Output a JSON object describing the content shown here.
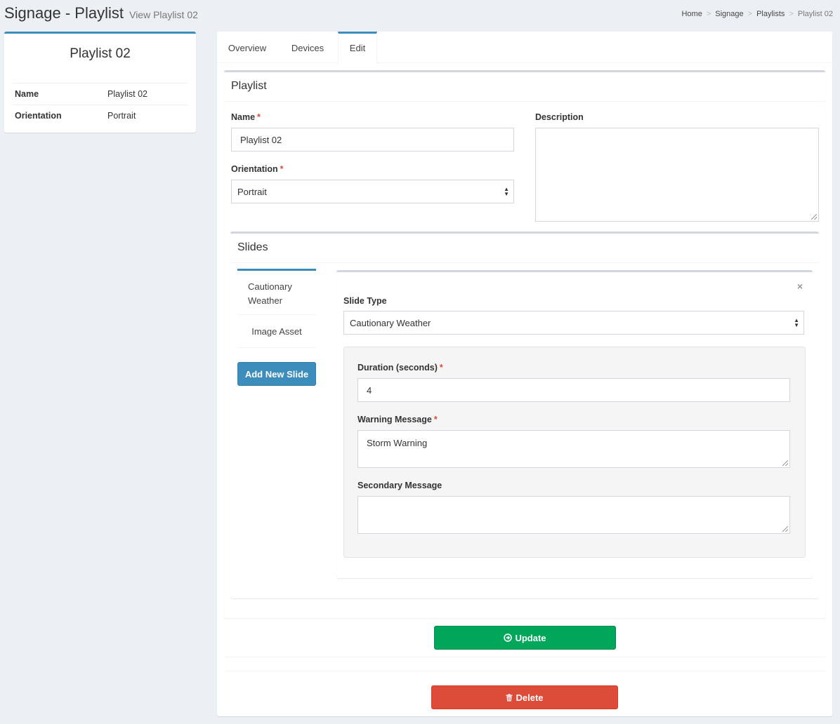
{
  "header": {
    "title": "Signage - Playlist",
    "subtitle": "View Playlist 02",
    "breadcrumb": [
      "Home",
      "Signage",
      "Playlists",
      "Playlist 02"
    ]
  },
  "profile": {
    "name": "Playlist 02",
    "rows": [
      {
        "key": "Name",
        "value": "Playlist 02"
      },
      {
        "key": "Orientation",
        "value": "Portrait"
      }
    ]
  },
  "tabs": [
    "Overview",
    "Devices",
    "Edit"
  ],
  "active_tab": "Edit",
  "playlist_form": {
    "title": "Playlist",
    "name_label": "Name",
    "name_value": "Playlist 02",
    "orientation_label": "Orientation",
    "orientation_value": "Portrait",
    "description_label": "Description",
    "description_value": "",
    "required_mark": "*"
  },
  "slides": {
    "title": "Slides",
    "items": [
      "Cautionary Weather",
      "Image Asset"
    ],
    "add_label": "Add New Slide",
    "close_glyph": "×",
    "slide_type_label": "Slide Type",
    "slide_type_value": "Cautionary Weather",
    "duration_label": "Duration (seconds)",
    "duration_value": "4",
    "warning_label": "Warning Message",
    "warning_value": "Storm Warning",
    "secondary_label": "Secondary Message",
    "secondary_value": ""
  },
  "actions": {
    "update_label": "Update",
    "delete_label": "Delete"
  },
  "colors": {
    "primary": "#3c8dbc",
    "success": "#00a65a",
    "danger": "#dd4b39",
    "background": "#ecf0f5"
  }
}
